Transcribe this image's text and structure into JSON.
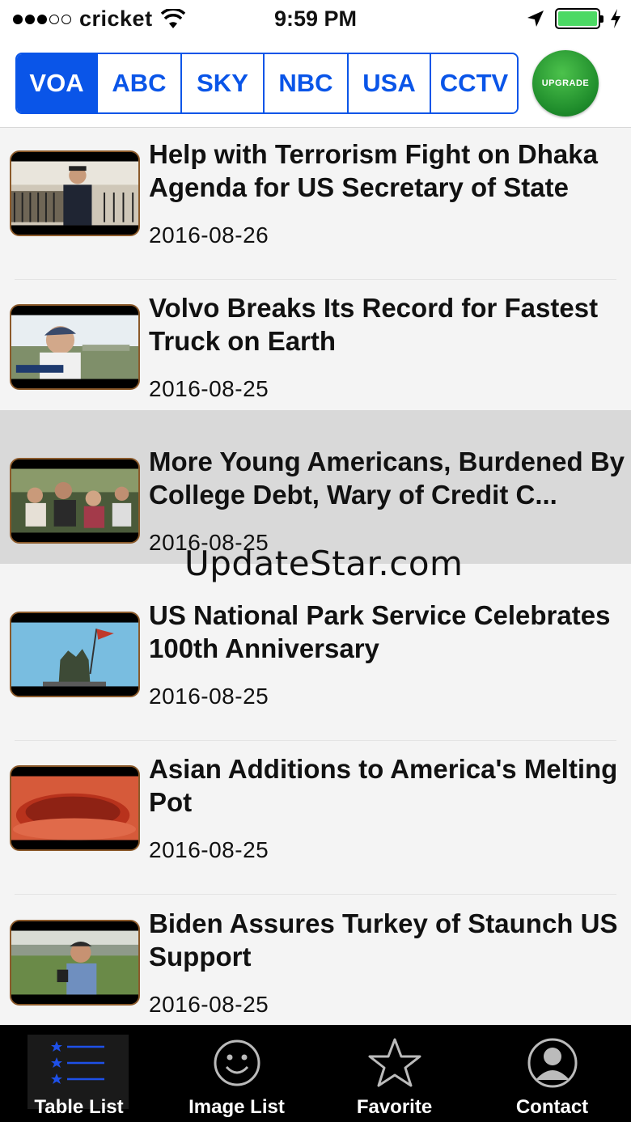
{
  "status": {
    "carrier": "cricket",
    "time": "9:59 PM"
  },
  "tabs": [
    {
      "label": "VOA",
      "active": true
    },
    {
      "label": "ABC",
      "active": false
    },
    {
      "label": "SKY",
      "active": false
    },
    {
      "label": "NBC",
      "active": false
    },
    {
      "label": "USA",
      "active": false
    },
    {
      "label": "CCTV",
      "active": false
    }
  ],
  "upgrade_label": "UPGRADE",
  "articles": [
    {
      "title": "Help with Terrorism Fight on Dhaka Agenda for US Secretary of State",
      "date": "2016-08-26"
    },
    {
      "title": "Volvo Breaks Its Record for Fastest Truck on Earth",
      "date": "2016-08-25"
    },
    {
      "title": "More Young Americans, Burdened By College Debt, Wary of Credit C...",
      "date": "2016-08-25",
      "highlighted": true
    },
    {
      "title": "US National Park Service Celebrates 100th Anniversary",
      "date": "2016-08-25"
    },
    {
      "title": "Asian Additions to America's Melting Pot",
      "date": "2016-08-25"
    },
    {
      "title": "Biden Assures Turkey of Staunch US Support",
      "date": "2016-08-25"
    }
  ],
  "watermark": "UpdateStar.com",
  "tabbar": [
    {
      "label": "Table List",
      "icon": "table-list-icon",
      "active": true
    },
    {
      "label": "Image List",
      "icon": "smiley-icon",
      "active": false
    },
    {
      "label": "Favorite",
      "icon": "star-icon",
      "active": false
    },
    {
      "label": "Contact",
      "icon": "contact-icon",
      "active": false
    }
  ],
  "colors": {
    "accent": "#0a55e8",
    "upgrade": "#1d8a2a",
    "battery": "#4cd964",
    "thumb_border": "#8b5a2b"
  }
}
